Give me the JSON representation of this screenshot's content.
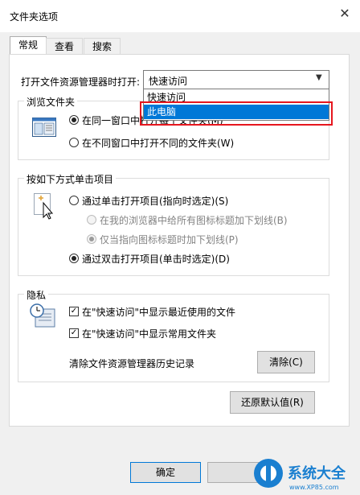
{
  "window": {
    "title": "文件夹选项"
  },
  "tabs": [
    {
      "label": "常规",
      "active": true
    },
    {
      "label": "查看",
      "active": false
    },
    {
      "label": "搜索",
      "active": false
    }
  ],
  "open_explorer": {
    "label": "打开文件资源管理器时打开:",
    "selected_value": "快速访问",
    "options": [
      "快速访问",
      "此电脑"
    ],
    "highlighted_option": "此电脑"
  },
  "browse_folders": {
    "group_label": "浏览文件夹",
    "option_same_window": "在同一窗口中打开每个文件夹(M)",
    "option_new_window": "在不同窗口中打开不同的文件夹(W)",
    "selected": "same_window"
  },
  "click_items": {
    "group_label": "按如下方式单击项目",
    "option_single_click": "通过单击打开项目(指向时选定)(S)",
    "sub_underline_browser": "在我的浏览器中给所有图标标题加下划线(B)",
    "sub_underline_hover": "仅当指向图标标题时加下划线(P)",
    "option_double_click": "通过双击打开项目(单击时选定)(D)",
    "selected": "double_click"
  },
  "privacy": {
    "group_label": "隐私",
    "show_recent_files": "在\"快速访问\"中显示最近使用的文件",
    "show_frequent_folders": "在\"快速访问\"中显示常用文件夹",
    "clear_history_label": "清除文件资源管理器历史记录",
    "clear_button": "清除(C)"
  },
  "restore_defaults_button": "还原默认值(R)",
  "footer": {
    "ok_button": "确定"
  },
  "watermark": {
    "brand": "系统大全",
    "url": "www.XP85.com"
  },
  "colors": {
    "accent": "#0078d7",
    "highlight_box": "#e6161e",
    "dialog_bg": "#f0f0f0"
  }
}
